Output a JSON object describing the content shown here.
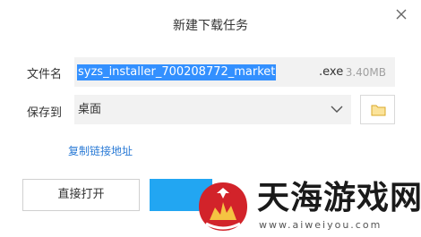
{
  "dialog": {
    "title": "新建下载任务"
  },
  "file_name": {
    "label": "文件名",
    "selected_text": "syzs_installer_700208772_market",
    "extension": ".exe",
    "size": "3.40MB"
  },
  "save_to": {
    "label": "保存到",
    "value": "桌面"
  },
  "copy_link_label": "复制链接地址",
  "buttons": {
    "direct_open": "直接打开"
  },
  "watermark": {
    "text": "天海游戏网",
    "url": "www.aiweiyou.com"
  },
  "colors": {
    "accent": "#22a6f2",
    "selection": "#3390ff",
    "link": "#2b7bd6",
    "field_bg": "#f2f2f2",
    "logo_red": "#d2232a",
    "folder": "#f5c342"
  },
  "icons": {
    "close": "close-icon",
    "dropdown": "chevron-down-icon",
    "browse": "folder-icon"
  }
}
